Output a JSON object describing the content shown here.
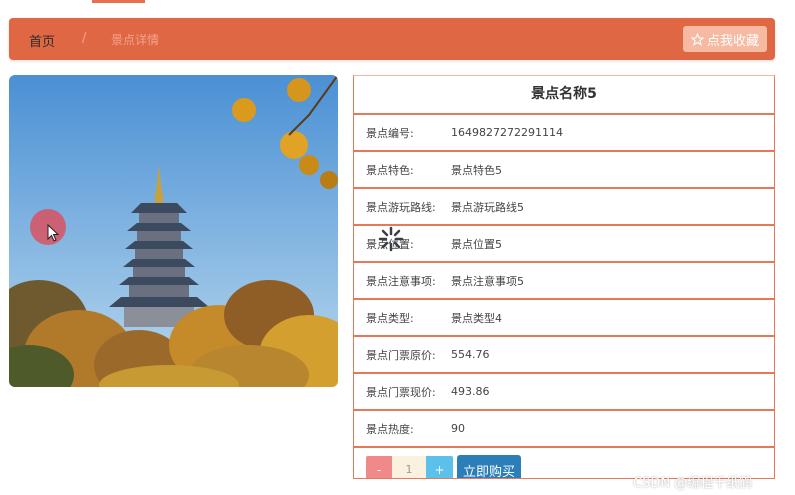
{
  "breadcrumb": {
    "home": "首页",
    "separator": "/",
    "current": "景点详情"
  },
  "favorite_button": {
    "icon": "star-icon",
    "label": "点我收藏"
  },
  "spot": {
    "title": "景点名称5",
    "fields": [
      {
        "label": "景点编号:",
        "value": "1649827272291114"
      },
      {
        "label": "景点特色:",
        "value": "景点特色5"
      },
      {
        "label": "景点游玩路线:",
        "value": "景点游玩路线5"
      },
      {
        "label": "景点位置:",
        "value": "景点位置5"
      },
      {
        "label": "景点注意事项:",
        "value": "景点注意事项5"
      },
      {
        "label": "景点类型:",
        "value": "景点类型4"
      },
      {
        "label": "景点门票原价:",
        "value": "554.76"
      },
      {
        "label": "景点门票现价:",
        "value": "493.86"
      },
      {
        "label": "景点热度:",
        "value": "90"
      }
    ]
  },
  "purchase": {
    "minus": "-",
    "quantity": "1",
    "plus": "+",
    "buy_label": "立即购买"
  },
  "watermark": "CSDN @编程千纸鹤",
  "colors": {
    "accent": "#e06744",
    "buy_button": "#2b7eb8",
    "minus_button": "#f08a8a",
    "plus_button": "#5bc0ea"
  }
}
